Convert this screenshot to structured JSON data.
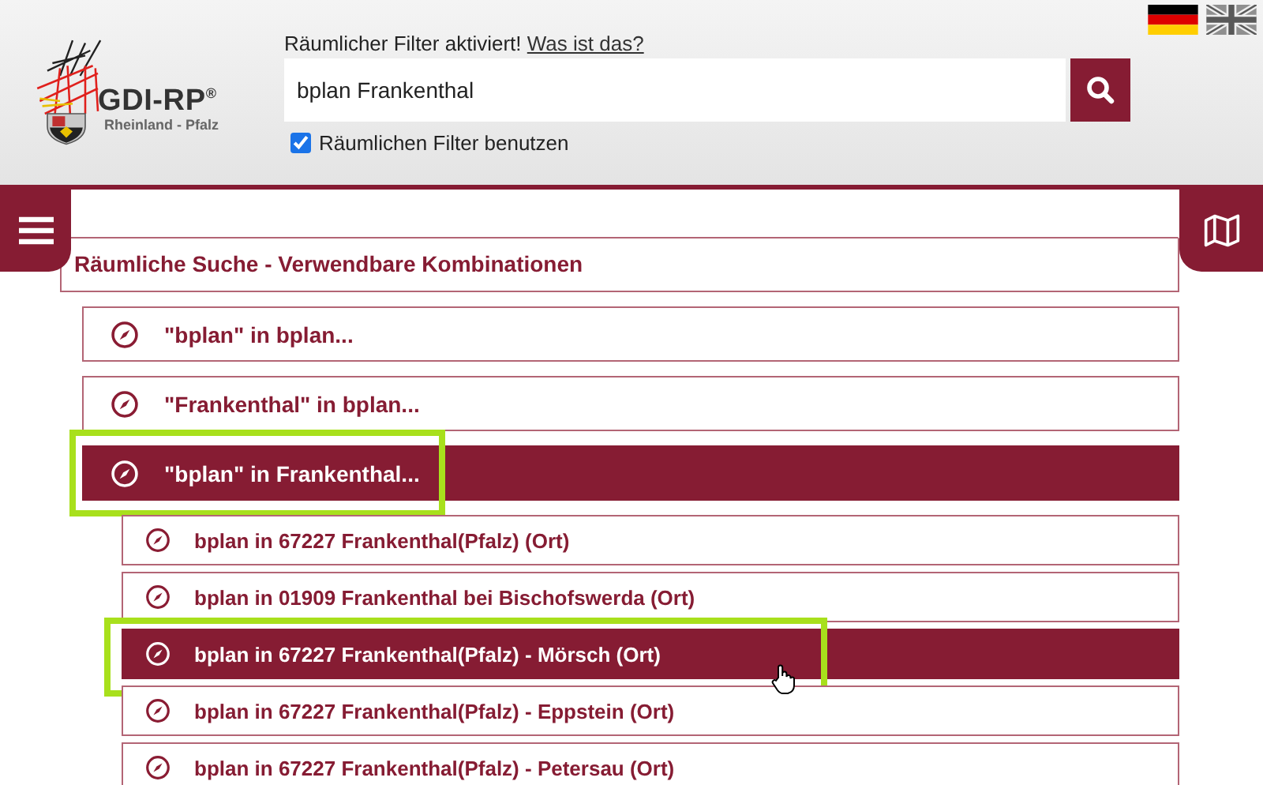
{
  "header": {
    "logo_title": "GDI-RP$^{®}$",
    "logo_subtitle": "Rheinland - Pfalz",
    "filter_notice": "Räumlicher Filter aktiviert!",
    "filter_link": "Was ist das?",
    "search": {
      "value": "bplan Frankenthal"
    },
    "filter_checkbox": {
      "label": "Räumlichen Filter benutzen",
      "checked": true
    },
    "languages": [
      {
        "kind": "de",
        "selected": true
      },
      {
        "kind": "en",
        "selected": false
      }
    ]
  },
  "results": {
    "heading": "Räumliche Suche - Verwendbare Kombinationen",
    "items": [
      {
        "label": "\"bplan\" in bplan...",
        "selected": false,
        "highlighted": false
      },
      {
        "label": "\"Frankenthal\" in bplan...",
        "selected": false,
        "highlighted": false
      },
      {
        "label": "\"bplan\" in Frankenthal...",
        "selected": true,
        "highlighted": true,
        "children": [
          {
            "label": "bplan in 67227 Frankenthal(Pfalz) (Ort)",
            "selected": false,
            "highlighted": false
          },
          {
            "label": "bplan in 01909 Frankenthal bei Bischofswerda (Ort)",
            "selected": false,
            "highlighted": false
          },
          {
            "label": "bplan in 67227 Frankenthal(Pfalz) - Mörsch (Ort)",
            "selected": true,
            "highlighted": true
          },
          {
            "label": "bplan in 67227 Frankenthal(Pfalz) - Eppstein (Ort)",
            "selected": false,
            "highlighted": false
          },
          {
            "label": "bplan in 67227 Frankenthal(Pfalz) - Petersau (Ort)",
            "selected": false,
            "highlighted": false
          }
        ]
      }
    ]
  }
}
